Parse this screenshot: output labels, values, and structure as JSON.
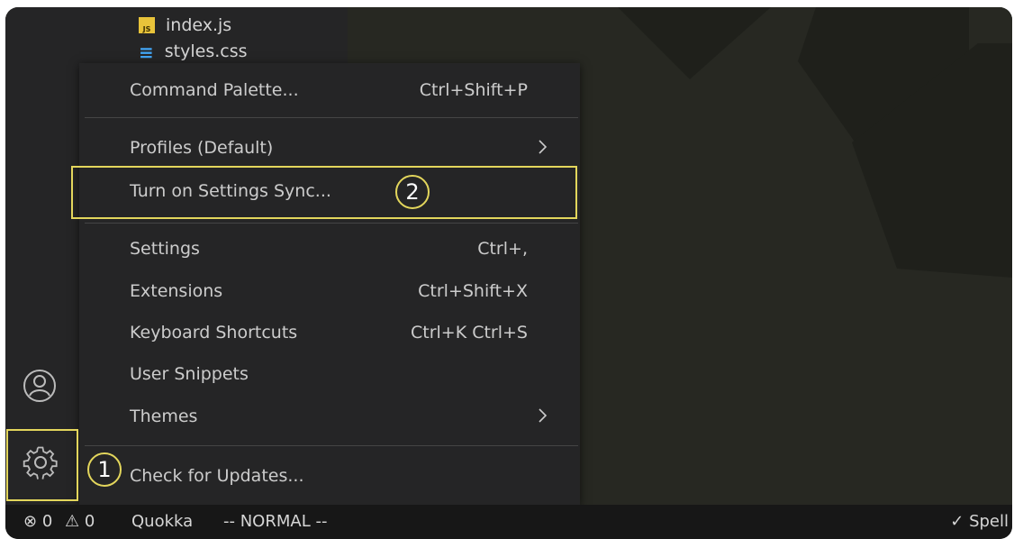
{
  "explorer": {
    "files": [
      {
        "name": "index.js",
        "icon": "js-file-icon"
      },
      {
        "name": "styles.css",
        "icon": "css-file-icon"
      }
    ]
  },
  "menu": {
    "items": [
      {
        "label": "Command Palette...",
        "shortcut": "Ctrl+Shift+P"
      },
      {
        "label": "Profiles (Default)",
        "shortcut": "",
        "submenu": true
      },
      {
        "label": "Turn on Settings Sync...",
        "shortcut": ""
      },
      {
        "label": "Settings",
        "shortcut": "Ctrl+,"
      },
      {
        "label": "Extensions",
        "shortcut": "Ctrl+Shift+X"
      },
      {
        "label": "Keyboard Shortcuts",
        "shortcut": "Ctrl+K Ctrl+S"
      },
      {
        "label": "User Snippets",
        "shortcut": ""
      },
      {
        "label": "Themes",
        "shortcut": "",
        "submenu": true
      },
      {
        "label": "Check for Updates...",
        "shortcut": ""
      }
    ]
  },
  "annotations": {
    "step1": "1",
    "step2": "2",
    "highlight_color": "#e3d65c"
  },
  "statusbar": {
    "errors": "0",
    "warnings": "0",
    "quokka": "Quokka",
    "mode": "-- NORMAL --",
    "spell": "Spell"
  },
  "colors": {
    "editor_bg": "#272822",
    "sidebar_bg": "#252526",
    "menu_bg": "#252526",
    "statusbar_bg": "#171717"
  }
}
